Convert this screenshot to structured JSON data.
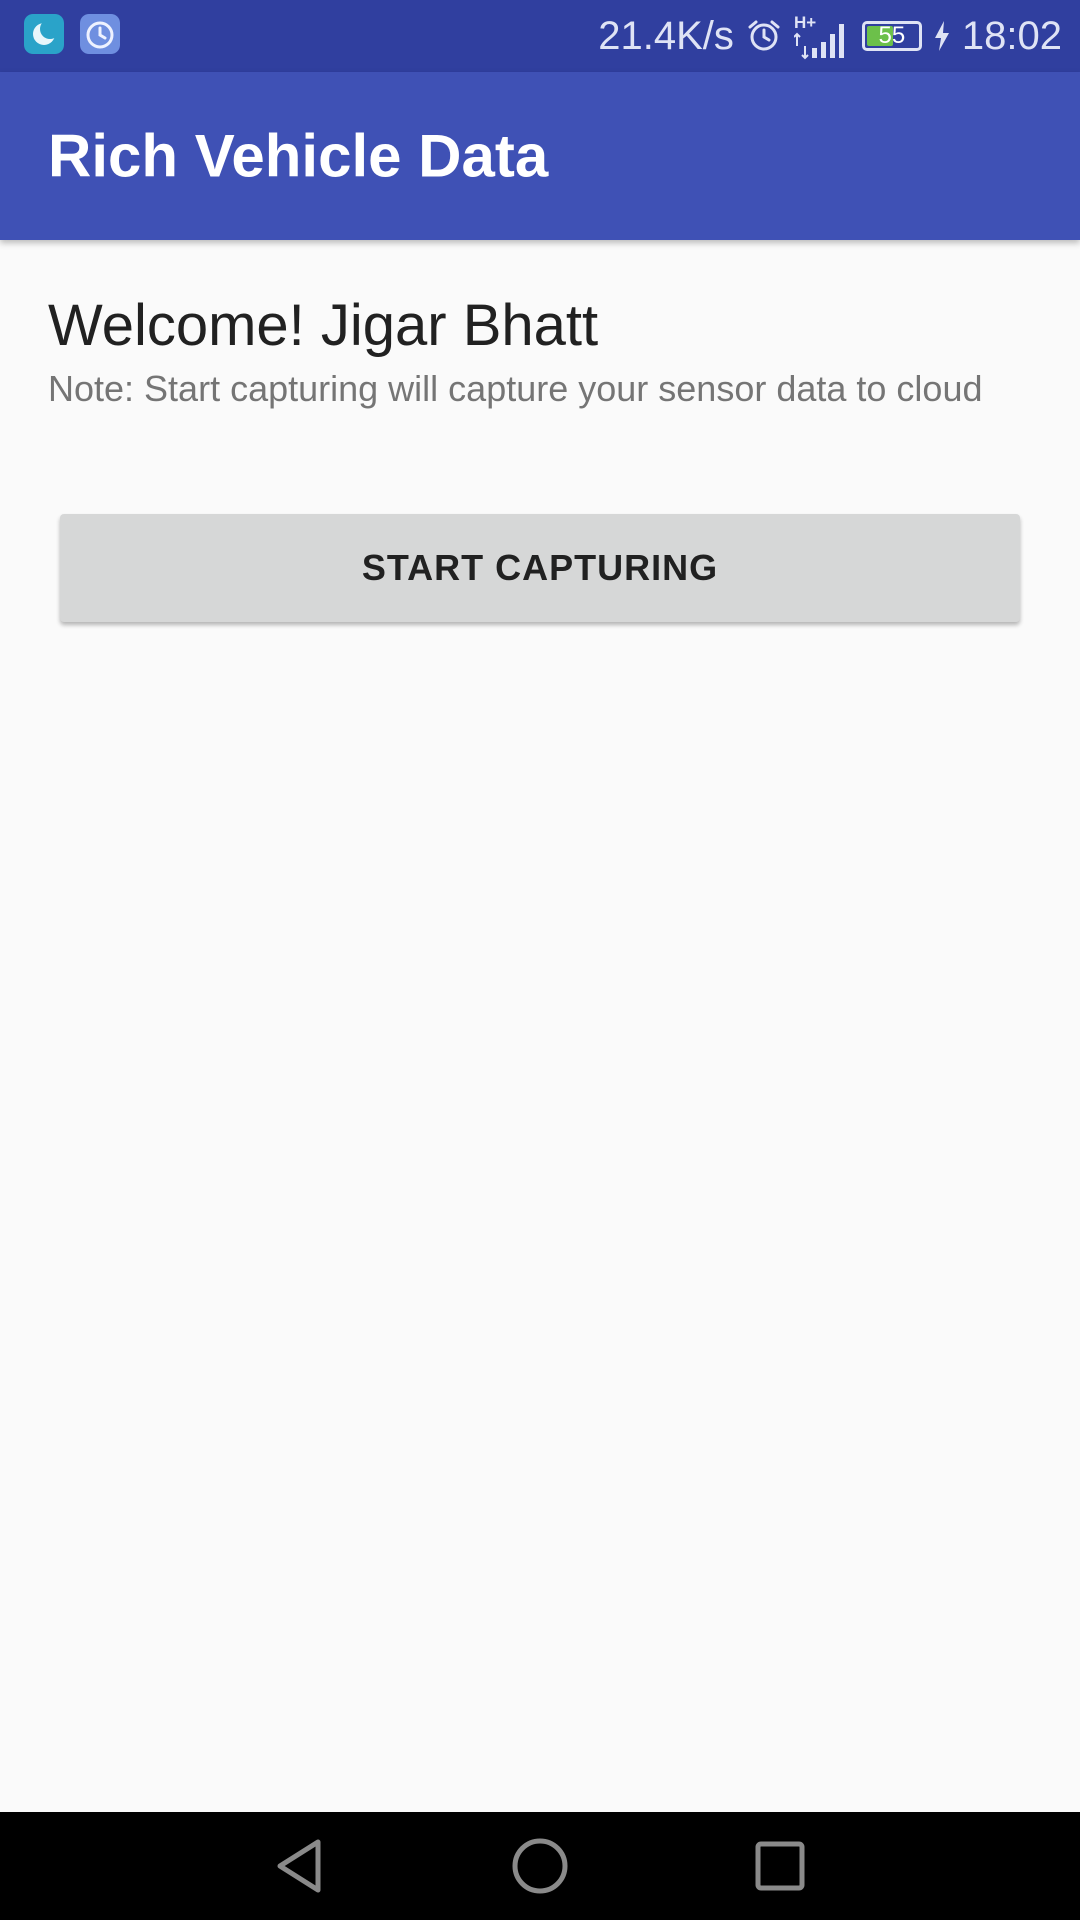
{
  "status_bar": {
    "notification_icons": [
      "moon-app-icon",
      "clock-app-icon"
    ],
    "network_speed": "21.4K/s",
    "alarm_icon": "alarm-clock-icon",
    "network_type_icon": "h-plus-signal-icon",
    "battery_level": "55",
    "battery_fraction": 0.55,
    "charging_icon": "lightning-bolt-icon",
    "time": "18:02"
  },
  "app_bar": {
    "title": "Rich Vehicle Data"
  },
  "main": {
    "welcome": "Welcome! Jigar Bhatt",
    "note": "Note: Start capturing will capture your sensor data to cloud",
    "start_button": "START CAPTURING"
  },
  "nav_bar": {
    "icons": [
      "back-triangle-icon",
      "home-circle-icon",
      "recents-square-icon"
    ]
  },
  "colors": {
    "status_bar": "#303f9f",
    "app_bar": "#3f51b5",
    "background": "#fafafa",
    "button": "#d6d7d7",
    "battery_fill": "#6cc04a"
  }
}
